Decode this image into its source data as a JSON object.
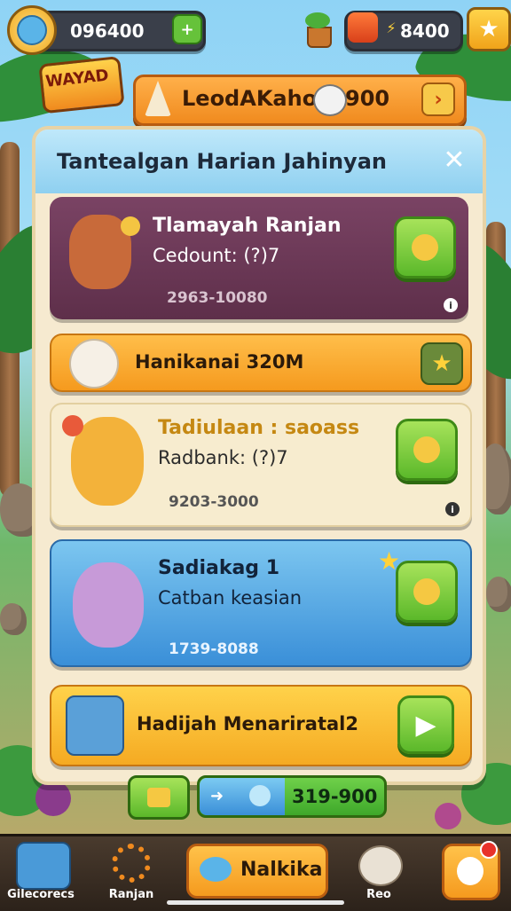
{
  "top_bar": {
    "coins_value": "096400",
    "gems_value": "8400"
  },
  "logo_text": "WAYAD",
  "banner": {
    "text": "LeodAKaho",
    "value": "900"
  },
  "panel": {
    "title": "Tantealgan Harian Jahinyan",
    "close": "✕"
  },
  "cards": [
    {
      "title": "Tlamayah Ranjan",
      "subtitle": "Cedount: (?)7",
      "range": "2963-10080"
    },
    {
      "title": "Hanikanai 320M"
    },
    {
      "title": "Tadiulaan : saoass",
      "subtitle": "Radbank: (?)7",
      "range": "9203-3000"
    },
    {
      "title": "Sadiakag 1",
      "subtitle": "Catban keasian",
      "range": "1739-8088"
    },
    {
      "title": "Hadijah Menariratal2"
    }
  ],
  "footer_bar": {
    "value": "319-900"
  },
  "bottom_nav": {
    "items": [
      {
        "label": "Gilecorecs"
      },
      {
        "label": "Ranjan"
      },
      {
        "label": "Nalkika"
      },
      {
        "label": "Reo"
      },
      {
        "label": ""
      }
    ]
  },
  "colors": {
    "card1": "#6e3a57",
    "card2": "#f5a623",
    "card3": "#f4e8c8",
    "card4": "#4aa3e0",
    "card5": "#f5b63a",
    "accent_green": "#5bb82a"
  }
}
